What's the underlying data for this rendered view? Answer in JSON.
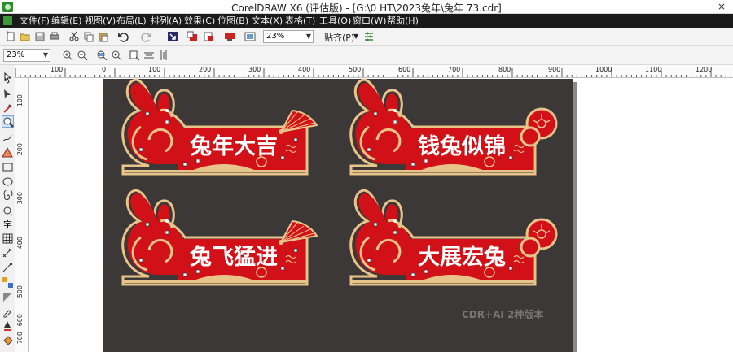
{
  "window": {
    "title": "CorelDRAW X6 (评估版) - [G:\\0 HT\\2023兔年\\兔年 73.cdr]",
    "close_glyph": "×"
  },
  "menu": [
    "文件(F)",
    "编辑(E)",
    "视图(V)",
    "布局(L)",
    "排列(A)",
    "效果(C)",
    "位图(B)",
    "文本(X)",
    "表格(T)",
    "工具(O)",
    "窗口(W)",
    "帮助(H)"
  ],
  "toolbar": {
    "zoom_value": "23%",
    "snap_label": "贴齐(P)"
  },
  "toolbar2": {
    "zoom_value": "23%"
  },
  "ruler_h_labels": [
    "100",
    "0",
    "100",
    "200",
    "300",
    "400",
    "500",
    "600",
    "700",
    "800",
    "900",
    "1000",
    "1100",
    "1200"
  ],
  "ruler_v_labels": [
    "100",
    "200",
    "300",
    "400",
    "500",
    "600",
    "700"
  ],
  "cards": [
    {
      "text": "兔年大吉",
      "ornament": "fan"
    },
    {
      "text": "钱兔似锦",
      "ornament": "flower"
    },
    {
      "text": "兔飞猛进",
      "ornament": "fan"
    },
    {
      "text": "大展宏兔",
      "ornament": "flower"
    }
  ],
  "watermark": "CDR+AI 2种版本",
  "colors": {
    "artboard": "#3d3838",
    "red": "#d21018",
    "gold": "#e8c48a"
  }
}
